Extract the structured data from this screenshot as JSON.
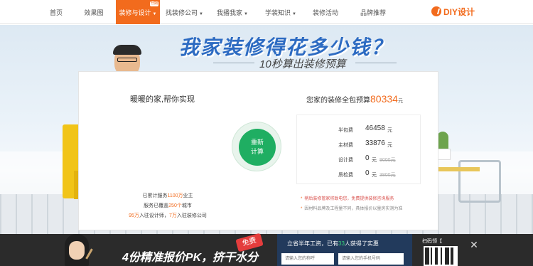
{
  "nav": {
    "items": [
      {
        "label": "首页",
        "dropdown": false,
        "active": false
      },
      {
        "label": "效果图",
        "dropdown": false,
        "active": false
      },
      {
        "label": "装修与设计",
        "dropdown": true,
        "active": true,
        "badge": "分期"
      },
      {
        "label": "找装修公司",
        "dropdown": true,
        "active": false
      },
      {
        "label": "我播我家",
        "dropdown": true,
        "active": false
      },
      {
        "label": "学装知识",
        "dropdown": true,
        "active": false
      },
      {
        "label": "装修活动",
        "dropdown": false,
        "active": false
      },
      {
        "label": "品牌推荐",
        "dropdown": false,
        "active": false
      }
    ],
    "diy_label": "DIY设计"
  },
  "hero": {
    "title": "我家装修得花多少钱？",
    "subtitle": "10秒算出装修预算"
  },
  "calculator": {
    "left_title": "暖暖的家,帮你实现",
    "button_line1": "重新",
    "button_line2": "计算",
    "stats": [
      {
        "prefix": "已累计服务",
        "highlight": "1100万",
        "suffix": "业主"
      },
      {
        "prefix": "服务已覆盖",
        "highlight": "250个",
        "suffix": "城市"
      },
      {
        "prefix": "",
        "highlight": "95万",
        "suffix": "入驻设计师，",
        "highlight2": "7万",
        "suffix2": "入驻装修公司"
      }
    ],
    "total_label": "您家的装修全包预算",
    "total_value": "80334",
    "total_unit": "元",
    "breakdown": [
      {
        "label": "半包费",
        "value": "46458",
        "unit": "元",
        "strike": ""
      },
      {
        "label": "主材费",
        "value": "33876",
        "unit": "元",
        "strike": ""
      },
      {
        "label": "设计费",
        "value": "0",
        "unit": "元",
        "strike": "9000元"
      },
      {
        "label": "质检费",
        "value": "0",
        "unit": "元",
        "strike": "3800元"
      }
    ],
    "notes": [
      "稍后装修管家将致电您，免费提供装修咨询服务",
      "因材料品牌及工程量不同，具体报价以量房实测为准"
    ]
  },
  "bottom_ad": {
    "slogan": "4份精准报价PK，挤干水分",
    "free_badge": "免费",
    "form_title_prefix": "立省半年工资，已有",
    "form_title_count": "33",
    "form_title_suffix": "人获得了实惠",
    "name_placeholder": "请输入您的称呼",
    "phone_placeholder": "请输入您的手机号码",
    "qr_label": "扫码领【",
    "colors": {
      "accent": "#f26b1d",
      "green": "#1fae62",
      "title_blue": "#2d6bc2",
      "panel": "#223a5c"
    }
  }
}
